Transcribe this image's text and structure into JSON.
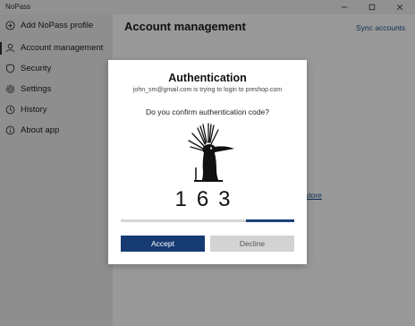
{
  "window": {
    "title": "NoPass"
  },
  "sidebar": {
    "items": [
      {
        "label": "Add NoPass profile",
        "icon": "add-circle-icon"
      },
      {
        "label": "Account management",
        "icon": "person-icon",
        "active": true
      },
      {
        "label": "Security",
        "icon": "shield-icon"
      },
      {
        "label": "Settings",
        "icon": "gear-icon"
      },
      {
        "label": "History",
        "icon": "history-icon"
      },
      {
        "label": "About app",
        "icon": "info-icon"
      }
    ]
  },
  "main": {
    "title": "Account management",
    "sync_link": "Sync accounts",
    "background_link": "store"
  },
  "dialog": {
    "title": "Authentication",
    "subtitle": "john_sm@gmail.com is trying to login to preshop.com",
    "question": "Do you confirm authentication code?",
    "code": "163",
    "progress_remaining": 0.28,
    "accept_label": "Accept",
    "decline_label": "Decline"
  },
  "colors": {
    "accent": "#163b72",
    "link": "#1a4f8b",
    "sidebar_bg": "#ededed"
  }
}
